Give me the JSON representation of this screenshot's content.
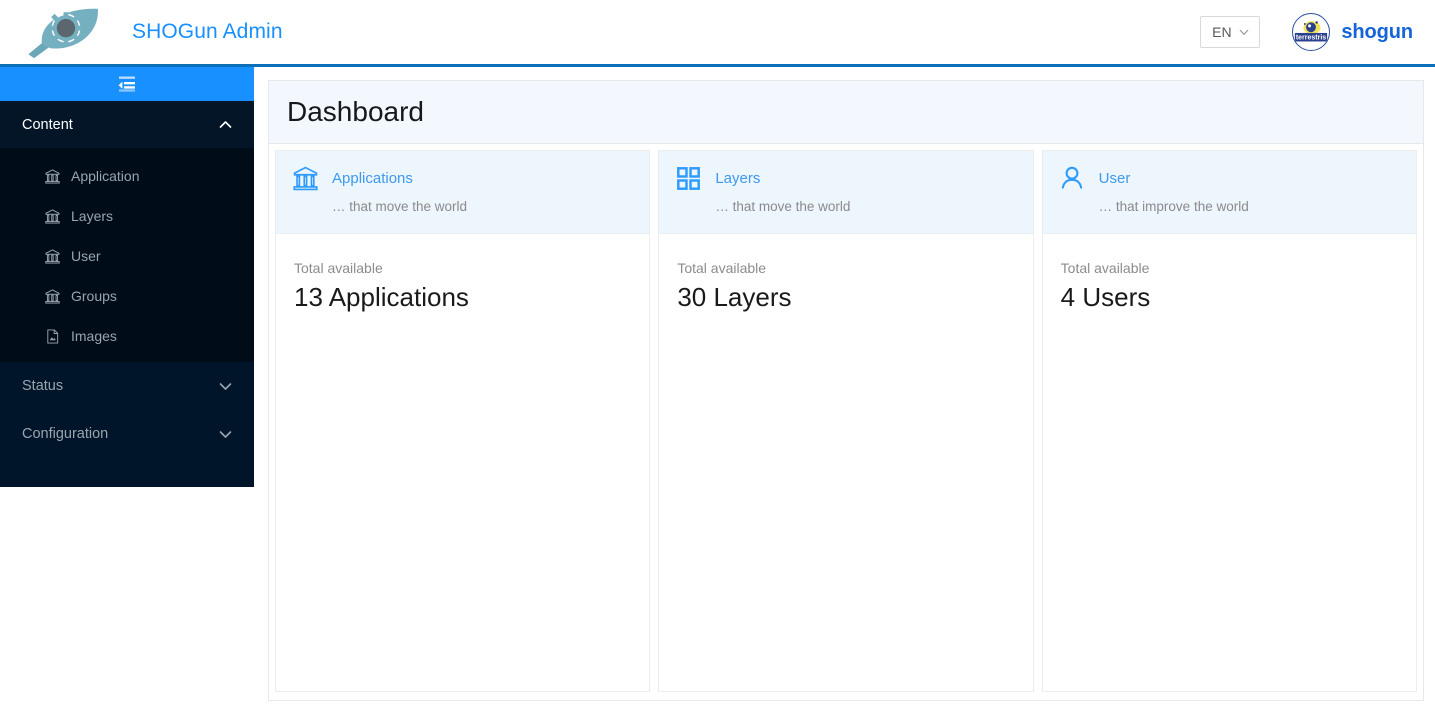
{
  "header": {
    "logo_icon": "shogun-leaf-gear-logo",
    "title": "SHOGun Admin",
    "language": {
      "value": "EN",
      "chevron_icon": "chevron-down-icon"
    },
    "avatar_icon": "terrestris-avatar",
    "avatar_text": "terrestris",
    "username": "shogun",
    "accent_color": "#1890ff",
    "border_color": "#0c70b8"
  },
  "sidebar": {
    "collapse_icon": "menu-fold-icon",
    "groups": [
      {
        "label": "Content",
        "expanded": true,
        "arrow_icon": "chevron-up-icon",
        "items": [
          {
            "label": "Application",
            "icon": "bank-icon"
          },
          {
            "label": "Layers",
            "icon": "bank-icon"
          },
          {
            "label": "User",
            "icon": "bank-icon"
          },
          {
            "label": "Groups",
            "icon": "bank-icon"
          },
          {
            "label": "Images",
            "icon": "file-image-icon"
          }
        ]
      },
      {
        "label": "Status",
        "expanded": false,
        "arrow_icon": "chevron-down-icon",
        "items": []
      },
      {
        "label": "Configuration",
        "expanded": false,
        "arrow_icon": "chevron-down-icon",
        "items": []
      }
    ]
  },
  "main": {
    "page_title": "Dashboard",
    "cards": [
      {
        "icon": "bank-icon",
        "title": "Applications",
        "subtitle": "… that move the world",
        "total_label": "Total available",
        "total_value": "13 Applications"
      },
      {
        "icon": "appstore-grid-icon",
        "title": "Layers",
        "subtitle": "… that move the world",
        "total_label": "Total available",
        "total_value": "30 Layers"
      },
      {
        "icon": "user-icon",
        "title": "User",
        "subtitle": "… that improve the world",
        "total_label": "Total available",
        "total_value": "4 Users"
      }
    ]
  }
}
